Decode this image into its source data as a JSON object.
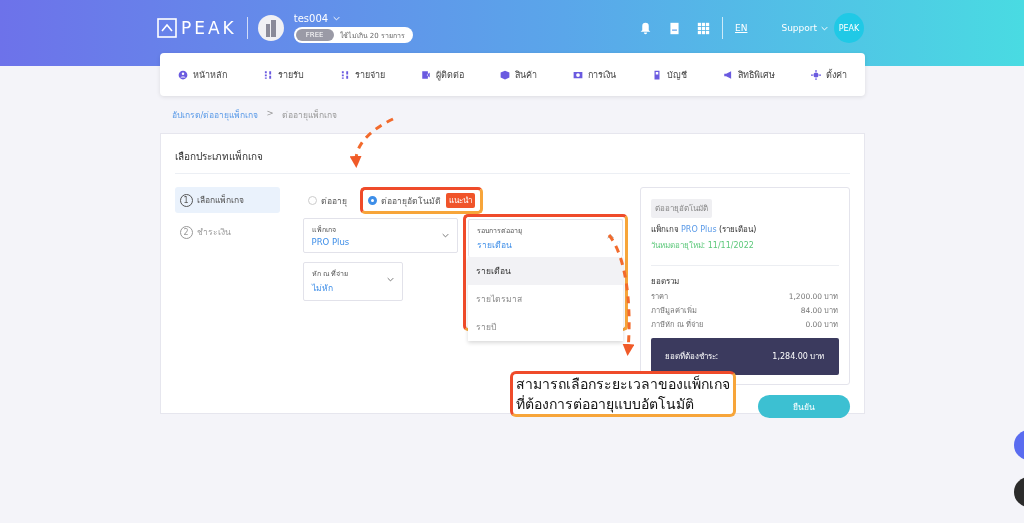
{
  "header": {
    "logo": "PEAK",
    "user": "tes004",
    "plan_badge": "FREE",
    "plan_limit": "ใช้ไม่เกิน 20 รายการ",
    "language": "EN",
    "support": "Support",
    "avatar_text": "PEAK"
  },
  "nav": [
    {
      "label": "หน้าหลัก"
    },
    {
      "label": "รายรับ"
    },
    {
      "label": "รายจ่าย"
    },
    {
      "label": "ผู้ติดต่อ"
    },
    {
      "label": "สินค้า"
    },
    {
      "label": "การเงิน"
    },
    {
      "label": "บัญชี"
    },
    {
      "label": "สิทธิพิเศษ"
    },
    {
      "label": "ตั้งค่า"
    }
  ],
  "breadcrumb": {
    "link": "อัปเกรด/ต่ออายุแพ็กเกจ",
    "separator": ">",
    "current": "ต่ออายุแพ็กเกจ"
  },
  "card_title": "เลือกประเภทแพ็กเกจ",
  "steps": [
    {
      "number": "1",
      "label": "เลือกแพ็กเกจ",
      "selected": true
    },
    {
      "number": "2",
      "label": "ชำระเงิน",
      "selected": false
    }
  ],
  "renewal_options": [
    {
      "label": "ต่ออายุ",
      "selected": false
    },
    {
      "label": "ต่ออายุอัตโนมัติ",
      "selected": true,
      "badge": "แนะนำ"
    }
  ],
  "package_field": {
    "label": "แพ็กเกจ",
    "value": "PRO Plus"
  },
  "withholding_field": {
    "label": "หัก ณ ที่จ่าย",
    "value": "ไม่หัก"
  },
  "cycle_field": {
    "label": "รอบการต่ออายุ",
    "value": "รายเดือน",
    "expanded": true,
    "options": [
      {
        "label": "รายเดือน",
        "selected": true
      },
      {
        "label": "รายไตรมาส",
        "selected": false
      },
      {
        "label": "รายปี",
        "selected": false
      }
    ]
  },
  "summary": {
    "tag": "ต่ออายุอัตโนมัติ",
    "package_prefix": "แพ็กเกจ",
    "package_name": "PRO Plus",
    "package_period": "(รายเดือน)",
    "expiry": "วันหมดอายุใหม่: 11/11/2022",
    "total_heading": "ยอดรวม",
    "rows": [
      {
        "label": "ราคา",
        "amount": "1,200.00",
        "unit": "บาท"
      },
      {
        "label": "ภาษีมูลค่าเพิ่ม",
        "amount": "84.00",
        "unit": "บาท"
      },
      {
        "label": "ภาษีหัก ณ ที่จ่าย",
        "amount": "0.00",
        "unit": "บาท"
      }
    ],
    "due_label": "ยอดที่ต้องชำระ:",
    "due_amount": "1,284.00 บาท"
  },
  "confirm_button": "ยืนยัน",
  "annotation": [
    "สามารถเลือกระยะเวลาของแพ็กเกจ",
    "ที่ต้องการต่ออายุแบบอัตโนมัติ"
  ]
}
